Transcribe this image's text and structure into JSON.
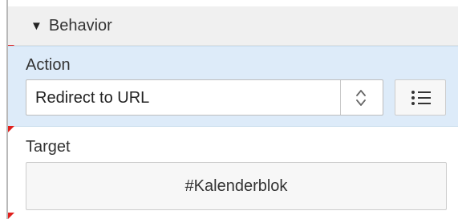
{
  "section": {
    "title": "Behavior",
    "expanded": true
  },
  "action": {
    "label": "Action",
    "selected_value": "Redirect to URL"
  },
  "target": {
    "label": "Target",
    "value": "#Kalenderblok"
  },
  "icons": {
    "section_toggle": "triangle-down-icon",
    "select_arrows": "chevron-up-down-icon",
    "list_button": "list-icon"
  },
  "colors": {
    "header_bg": "#f0f0f0",
    "selected_row_bg": "#ddebf9",
    "required_marker": "#e0201d"
  }
}
